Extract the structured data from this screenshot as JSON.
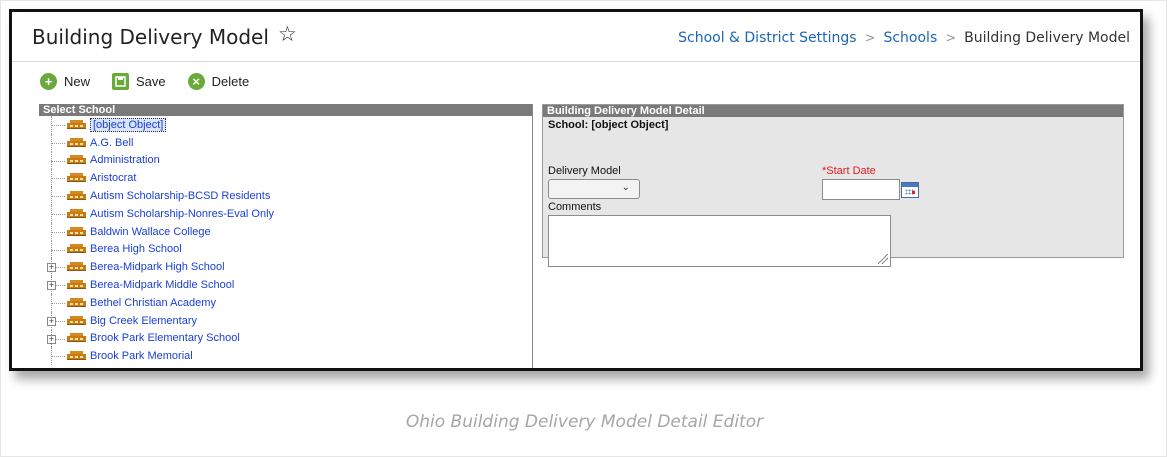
{
  "header": {
    "title": "Building Delivery Model",
    "favorite_icon": "star-outline-icon",
    "breadcrumb": [
      "School & District Settings",
      "Schools",
      "Building Delivery Model"
    ]
  },
  "toolbar": {
    "new_label": "New",
    "save_label": "Save",
    "delete_label": "Delete",
    "new_icon": "plus-circle-icon",
    "save_icon": "floppy-disk-icon",
    "delete_icon": "x-circle-icon",
    "icon_color": "#6aaa3a"
  },
  "school_tree": {
    "header": "Select School",
    "items": [
      {
        "label": "[object Object]",
        "expandable": false,
        "selected": true
      },
      {
        "label": "A.G. Bell",
        "expandable": false,
        "selected": false
      },
      {
        "label": "Administration",
        "expandable": false,
        "selected": false
      },
      {
        "label": "Aristocrat",
        "expandable": false,
        "selected": false
      },
      {
        "label": "Autism Scholarship-BCSD Residents",
        "expandable": false,
        "selected": false
      },
      {
        "label": "Autism Scholarship-Nonres-Eval Only",
        "expandable": false,
        "selected": false
      },
      {
        "label": "Baldwin Wallace College",
        "expandable": false,
        "selected": false
      },
      {
        "label": "Berea High School",
        "expandable": false,
        "selected": false
      },
      {
        "label": "Berea-Midpark High School",
        "expandable": true,
        "selected": false
      },
      {
        "label": "Berea-Midpark Middle School",
        "expandable": true,
        "selected": false
      },
      {
        "label": "Bethel Christian Academy",
        "expandable": false,
        "selected": false
      },
      {
        "label": "Big Creek Elementary",
        "expandable": true,
        "selected": false
      },
      {
        "label": "Brook Park Elementary School",
        "expandable": true,
        "selected": false
      },
      {
        "label": "Brook Park Memorial",
        "expandable": false,
        "selected": false
      }
    ]
  },
  "detail": {
    "header": "Building Delivery Model Detail",
    "school_line": "School: [object Object]",
    "delivery_model_label": "Delivery Model",
    "delivery_model_value": "",
    "start_date_label": "*Start Date",
    "start_date_value": "",
    "comments_label": "Comments",
    "comments_value": ""
  },
  "caption": "Ohio Building Delivery Model Detail Editor"
}
